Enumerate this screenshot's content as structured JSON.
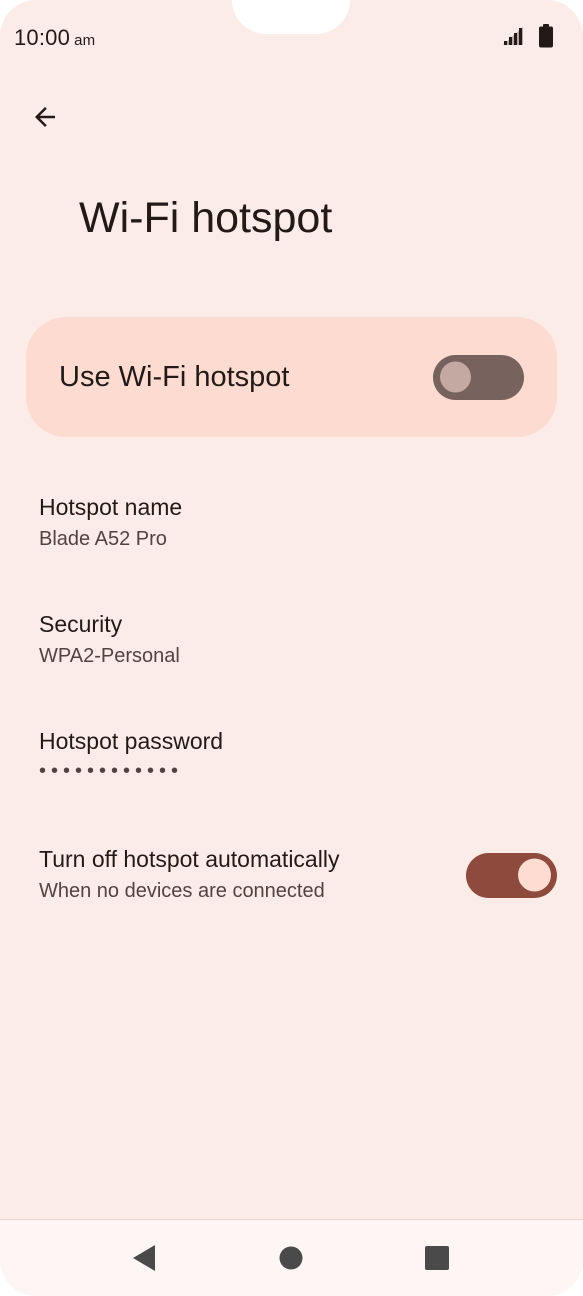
{
  "status_bar": {
    "time": "10:00",
    "ampm": "am",
    "icons": [
      "signal-icon",
      "battery-icon"
    ]
  },
  "header": {
    "back_icon": "arrow-left-icon",
    "title": "Wi-Fi hotspot"
  },
  "master_switch": {
    "label": "Use Wi-Fi hotspot",
    "enabled": false
  },
  "settings": [
    {
      "title": "Hotspot name",
      "summary": "Blade A52 Pro"
    },
    {
      "title": "Security",
      "summary": "WPA2-Personal"
    },
    {
      "title": "Hotspot password",
      "summary": "••••••••••••"
    },
    {
      "title": "Turn off hotspot automatically",
      "summary": "When no devices are connected",
      "enabled": true
    }
  ],
  "nav_bar": {
    "icons": [
      "back-triangle-icon",
      "home-circle-icon",
      "recents-square-icon"
    ]
  },
  "colors": {
    "background": "#fcece7",
    "master_switch_bg": "#fddbd1",
    "toggle_on_track": "#8e4a3c",
    "toggle_off_track": "#77625d",
    "text_primary": "#231a17",
    "text_secondary": "#53433f"
  }
}
